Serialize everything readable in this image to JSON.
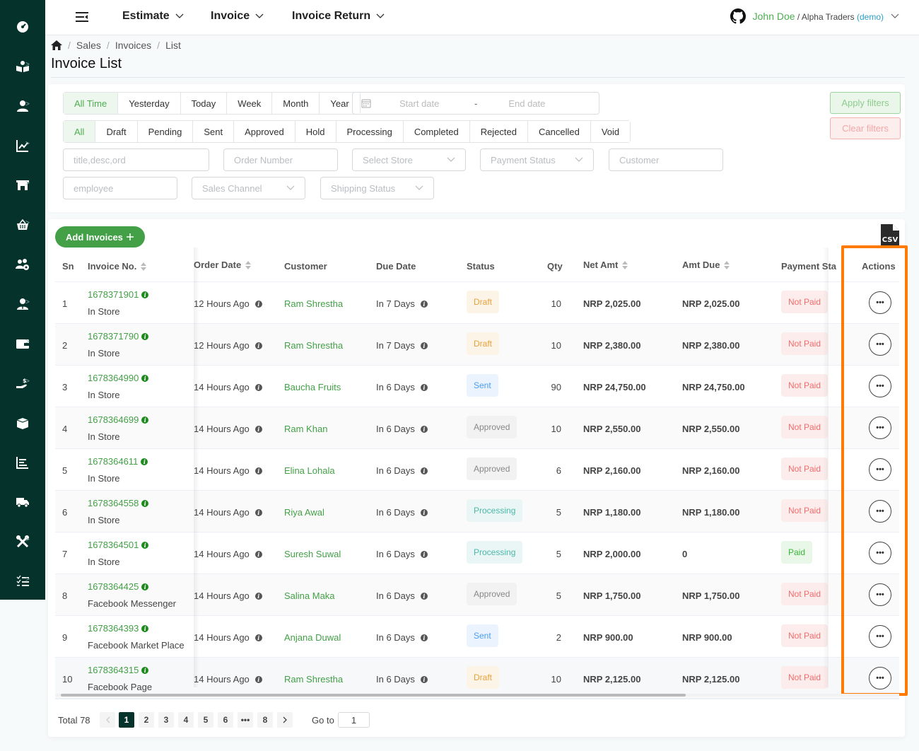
{
  "sidebar": {
    "items": [
      {
        "icon": "dashboard-icon",
        "has_submenu": false
      },
      {
        "icon": "catalog-icon",
        "has_submenu": true
      },
      {
        "icon": "user-icon",
        "has_submenu": true
      },
      {
        "icon": "chart-icon",
        "has_submenu": true
      },
      {
        "icon": "store-icon",
        "has_submenu": true
      },
      {
        "icon": "basket-icon",
        "has_submenu": true
      },
      {
        "icon": "team-settings-icon",
        "has_submenu": false
      },
      {
        "icon": "employee-icon",
        "has_submenu": true
      },
      {
        "icon": "wallet-icon",
        "has_submenu": true
      },
      {
        "icon": "payment-hand-icon",
        "has_submenu": true
      },
      {
        "icon": "box-icon",
        "has_submenu": false
      },
      {
        "icon": "report-icon",
        "has_submenu": false
      },
      {
        "icon": "truck-icon",
        "has_submenu": false
      },
      {
        "icon": "tools-icon",
        "has_submenu": true
      },
      {
        "icon": "checklist-icon",
        "has_submenu": true
      }
    ]
  },
  "header": {
    "menus": [
      "Estimate",
      "Invoice",
      "Invoice Return"
    ],
    "user_name": "John Doe",
    "org": "/ Alpha Traders",
    "demo_label": "(demo)"
  },
  "breadcrumb": [
    "Sales",
    "Invoices",
    "List"
  ],
  "page_title": "Invoice List",
  "filters": {
    "time_ranges": [
      "All Time",
      "Yesterday",
      "Today",
      "Week",
      "Month",
      "Year"
    ],
    "active_time_range": "All Time",
    "date_start_placeholder": "Start date",
    "date_separator": "-",
    "date_end_placeholder": "End date",
    "statuses": [
      "All",
      "Draft",
      "Pending",
      "Sent",
      "Approved",
      "Hold",
      "Processing",
      "Completed",
      "Rejected",
      "Cancelled",
      "Void"
    ],
    "active_status": "All",
    "search_placeholder": "title,desc,ord",
    "order_number_placeholder": "Order Number",
    "store_placeholder": "Select Store",
    "payment_status_placeholder": "Payment Status",
    "customer_placeholder": "Customer",
    "employee_placeholder": "employee",
    "sales_channel_placeholder": "Sales Channel",
    "shipping_status_placeholder": "Shipping Status",
    "apply_label": "Apply filters",
    "clear_label": "Clear filters"
  },
  "table": {
    "add_button": "Add Invoices",
    "export_icon": "csv-icon",
    "columns": {
      "sn": "Sn",
      "invoice_no": "Invoice No.",
      "order_date": "Order Date",
      "customer": "Customer",
      "due_date": "Due Date",
      "status": "Status",
      "qty": "Qty",
      "net_amt": "Net Amt",
      "amt_due": "Amt Due",
      "payment_status": "Payment Sta",
      "actions": "Actions"
    },
    "rows": [
      {
        "sn": "1",
        "invoice_no": "1678371901",
        "channel": "In Store",
        "order_date": "12 Hours Ago",
        "customer": "Ram Shrestha",
        "due_date": "In 7 Days",
        "status": "Draft",
        "qty": "10",
        "net_amt": "NRP 2,025.00",
        "amt_due": "NRP 2,025.00",
        "payment_status": "Not Paid"
      },
      {
        "sn": "2",
        "invoice_no": "1678371790",
        "channel": "In Store",
        "order_date": "12 Hours Ago",
        "customer": "Ram Shrestha",
        "due_date": "In 7 Days",
        "status": "Draft",
        "qty": "10",
        "net_amt": "NRP 2,380.00",
        "amt_due": "NRP 2,380.00",
        "payment_status": "Not Paid"
      },
      {
        "sn": "3",
        "invoice_no": "1678364990",
        "channel": "In Store",
        "order_date": "14 Hours Ago",
        "customer": "Baucha Fruits",
        "due_date": "In 6 Days",
        "status": "Sent",
        "qty": "90",
        "net_amt": "NRP 24,750.00",
        "amt_due": "NRP 24,750.00",
        "payment_status": "Not Paid"
      },
      {
        "sn": "4",
        "invoice_no": "1678364699",
        "channel": "In Store",
        "order_date": "14 Hours Ago",
        "customer": "Ram Khan",
        "due_date": "In 6 Days",
        "status": "Approved",
        "qty": "10",
        "net_amt": "NRP 2,550.00",
        "amt_due": "NRP 2,550.00",
        "payment_status": "Not Paid"
      },
      {
        "sn": "5",
        "invoice_no": "1678364611",
        "channel": "In Store",
        "order_date": "14 Hours Ago",
        "customer": "Elina Lohala",
        "due_date": "In 6 Days",
        "status": "Approved",
        "qty": "6",
        "net_amt": "NRP 2,160.00",
        "amt_due": "NRP 2,160.00",
        "payment_status": "Not Paid"
      },
      {
        "sn": "6",
        "invoice_no": "1678364558",
        "channel": "In Store",
        "order_date": "14 Hours Ago",
        "customer": "Riya Awal",
        "due_date": "In 6 Days",
        "status": "Processing",
        "qty": "5",
        "net_amt": "NRP 1,180.00",
        "amt_due": "NRP 1,180.00",
        "payment_status": "Not Paid"
      },
      {
        "sn": "7",
        "invoice_no": "1678364501",
        "channel": "In Store",
        "order_date": "14 Hours Ago",
        "customer": "Suresh Suwal",
        "due_date": "In 6 Days",
        "status": "Processing",
        "qty": "5",
        "net_amt": "NRP 2,000.00",
        "amt_due": "0",
        "payment_status": "Paid"
      },
      {
        "sn": "8",
        "invoice_no": "1678364425",
        "channel": "Facebook Messenger",
        "order_date": "14 Hours Ago",
        "customer": "Salina Maka",
        "due_date": "In 6 Days",
        "status": "Approved",
        "qty": "5",
        "net_amt": "NRP 1,750.00",
        "amt_due": "NRP 1,750.00",
        "payment_status": "Not Paid"
      },
      {
        "sn": "9",
        "invoice_no": "1678364393",
        "channel": "Facebook Market Place",
        "order_date": "14 Hours Ago",
        "customer": "Anjana Duwal",
        "due_date": "In 6 Days",
        "status": "Sent",
        "qty": "2",
        "net_amt": "NRP 900.00",
        "amt_due": "NRP 900.00",
        "payment_status": "Not Paid"
      },
      {
        "sn": "10",
        "invoice_no": "1678364315",
        "channel": "Facebook Page",
        "order_date": "14 Hours Ago",
        "customer": "Ram Shrestha",
        "due_date": "In 6 Days",
        "status": "Draft",
        "qty": "10",
        "net_amt": "NRP 2,125.00",
        "amt_due": "NRP 2,125.00",
        "payment_status": "Not Paid"
      }
    ],
    "action_label": "•••"
  },
  "pagination": {
    "total_label": "Total 78",
    "pages": [
      "1",
      "2",
      "3",
      "4",
      "5",
      "6",
      "•••",
      "8"
    ],
    "current": "1",
    "goto_label": "Go to",
    "goto_value": "1"
  },
  "colors": {
    "sidebar_bg": "#05322b",
    "accent_green": "#43a047",
    "highlight": "#ff7a00"
  }
}
